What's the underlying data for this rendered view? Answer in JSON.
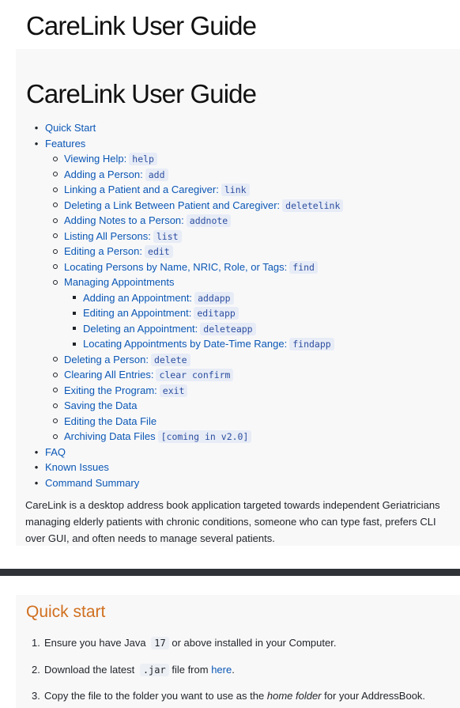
{
  "page_title": "CareLink User Guide",
  "panel1": {
    "heading": "CareLink User Guide",
    "toc": [
      {
        "level": 1,
        "label": "Quick Start",
        "code": ""
      },
      {
        "level": 1,
        "label": "Features",
        "code": ""
      },
      {
        "level": 2,
        "label": "Viewing Help:",
        "code": "help"
      },
      {
        "level": 2,
        "label": "Adding a Person:",
        "code": "add"
      },
      {
        "level": 2,
        "label": "Linking a Patient and a Caregiver:",
        "code": "link"
      },
      {
        "level": 2,
        "label": "Deleting a Link Between Patient and Caregiver:",
        "code": "deletelink"
      },
      {
        "level": 2,
        "label": "Adding Notes to a Person:",
        "code": "addnote"
      },
      {
        "level": 2,
        "label": "Listing All Persons:",
        "code": "list"
      },
      {
        "level": 2,
        "label": "Editing a Person:",
        "code": "edit"
      },
      {
        "level": 2,
        "label": "Locating Persons by Name, NRIC, Role, or Tags:",
        "code": "find"
      },
      {
        "level": 2,
        "label": "Managing Appointments",
        "code": ""
      },
      {
        "level": 3,
        "label": "Adding an Appointment:",
        "code": "addapp"
      },
      {
        "level": 3,
        "label": "Editing an Appointment:",
        "code": "editapp"
      },
      {
        "level": 3,
        "label": "Deleting an Appointment:",
        "code": "deleteapp"
      },
      {
        "level": 3,
        "label": "Locating Appointments by Date-Time Range:",
        "code": "findapp"
      },
      {
        "level": 2,
        "label": "Deleting a Person:",
        "code": "delete"
      },
      {
        "level": 2,
        "label": "Clearing All Entries:",
        "code": "clear confirm"
      },
      {
        "level": 2,
        "label": "Exiting the Program:",
        "code": "exit"
      },
      {
        "level": 2,
        "label": "Saving the Data",
        "code": ""
      },
      {
        "level": 2,
        "label": "Editing the Data File",
        "code": ""
      },
      {
        "level": 2,
        "label": "Archiving Data Files",
        "code": "[coming in v2.0]"
      },
      {
        "level": 1,
        "label": "FAQ",
        "code": ""
      },
      {
        "level": 1,
        "label": "Known Issues",
        "code": ""
      },
      {
        "level": 1,
        "label": "Command Summary",
        "code": ""
      }
    ],
    "intro": "CareLink is a desktop address book application targeted towards independent Geriatricians managing elderly patients with chronic conditions, someone who can type fast, prefers CLI over GUI, and often needs to manage several patients."
  },
  "panel2": {
    "heading": "Quick start",
    "steps": [
      {
        "num": "1.",
        "pre": "Ensure you have Java",
        "code": "17",
        "post": "or above installed in your Computer."
      },
      {
        "num": "2.",
        "pre": "Download the latest",
        "code": ".jar",
        "post": "file from",
        "link": "here",
        "end": "."
      },
      {
        "num": "3.",
        "pre": "Copy the file to the folder you want to use as the",
        "em": "home folder",
        "post": "for your AddressBook."
      }
    ]
  }
}
